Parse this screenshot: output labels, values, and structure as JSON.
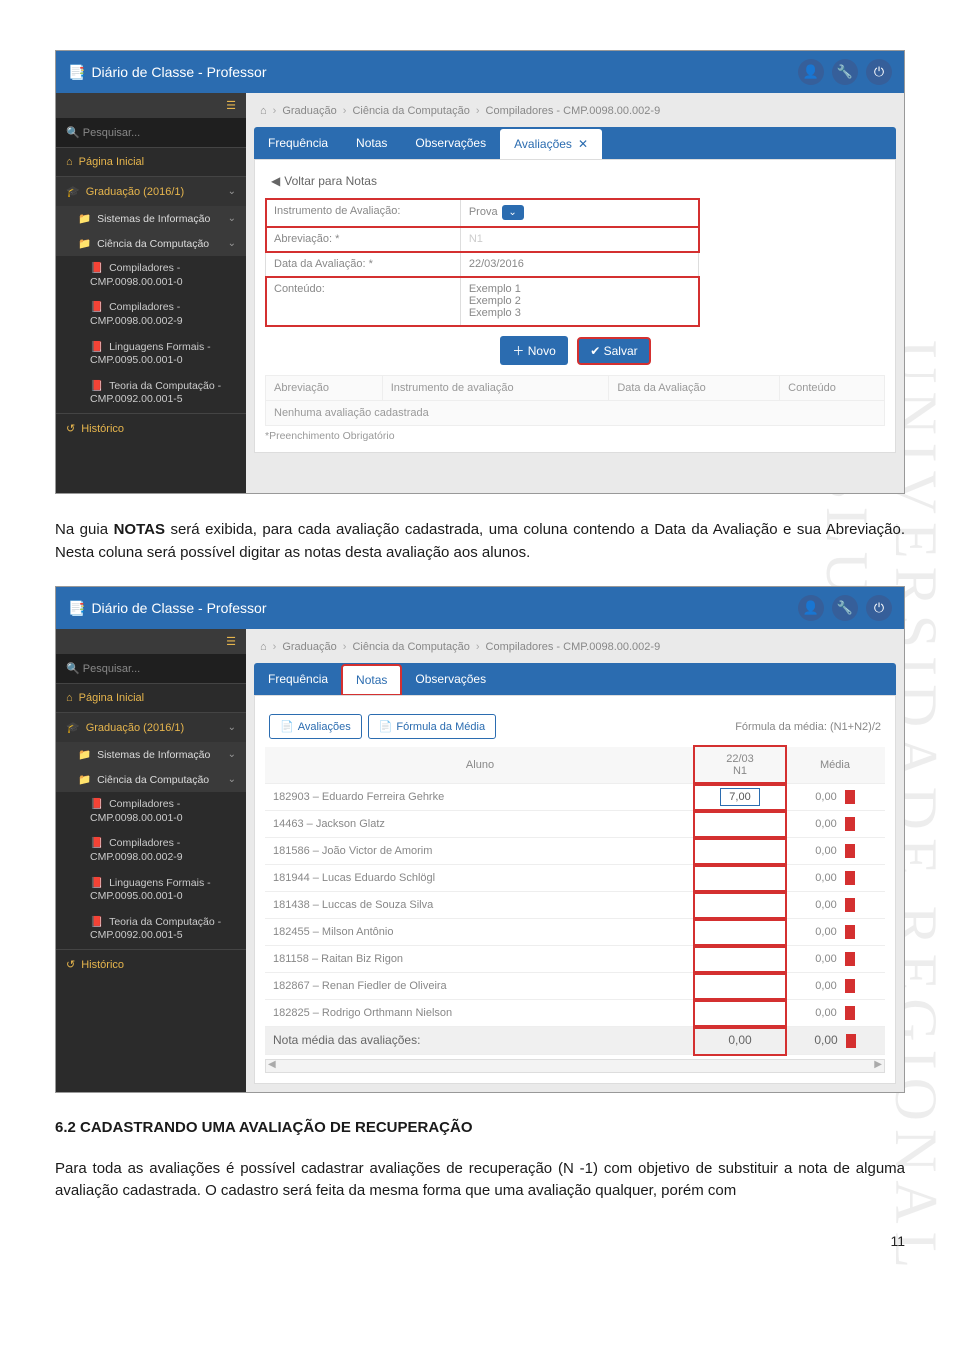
{
  "watermark": "UNIVERSIDADE REGIONAL DE BLUMENAU",
  "doc": {
    "para1_pre": "Na guia ",
    "para1_bold": "NOTAS",
    "para1_post": " será exibida, para cada avaliação cadastrada, uma coluna contendo a Data da Avaliação e sua Abreviação. Nesta coluna será possível digitar as notas desta avaliação aos alunos.",
    "heading": "6.2 CADASTRANDO UMA AVALIAÇÃO DE RECUPERAÇÃO",
    "para2": "Para toda as avaliações é possível cadastrar avaliações de recuperação (N -1) com objetivo de substituir a nota de alguma avaliação cadastrada. O cadastro será feita da mesma forma que uma avaliação qualquer, porém com",
    "pageNumber": "11"
  },
  "app": {
    "title": "Diário de Classe - Professor",
    "search_placeholder": "Pesquisar...",
    "breadcrumb": {
      "home_icon": "⌂",
      "level1": "Graduação",
      "level2": "Ciência da Computação",
      "level3": "Compiladores - CMP.0098.00.002-9"
    },
    "sidebar": {
      "home": "Página Inicial",
      "grad": "Graduação (2016/1)",
      "prog1": "Sistemas de Informação",
      "prog2": "Ciência da Computação",
      "leaf1": "Compiladores - CMP.0098.00.001-0",
      "leaf2": "Compiladores - CMP.0098.00.002-9",
      "leaf3": "Linguagens Formais - CMP.0095.00.001-0",
      "leaf4": "Teoria da Computação - CMP.0092.00.001-5",
      "hist": "Histórico"
    }
  },
  "shot1": {
    "tabs": {
      "freq": "Frequência",
      "notas": "Notas",
      "obs": "Observações",
      "aval": "Avaliações"
    },
    "back": "Voltar para Notas",
    "form": {
      "instr_label": "Instrumento de Avaliação:",
      "instr_value": "Prova",
      "abrev_label": "Abreviação: *",
      "abrev_value": "N1",
      "data_label": "Data da Avaliação: *",
      "data_value": "22/03/2016",
      "cont_label": "Conteúdo:",
      "cont_v1": "Exemplo 1",
      "cont_v2": "Exemplo 2",
      "cont_v3": "Exemplo 3"
    },
    "btn_novo": "Novo",
    "btn_salvar": "Salvar",
    "evalTable": {
      "h1": "Abreviação",
      "h2": "Instrumento de avaliação",
      "h3": "Data da Avaliação",
      "h4": "Conteúdo",
      "empty": "Nenhuma avaliação cadastrada"
    },
    "footnote": "*Preenchimento Obrigatório"
  },
  "shot2": {
    "tabs": {
      "freq": "Frequência",
      "notas": "Notas",
      "obs": "Observações"
    },
    "btn_aval": "Avaliações",
    "btn_formula": "Fórmula da Média",
    "formula_text": "Fórmula da média: (N1+N2)/2",
    "table": {
      "h_aluno": "Aluno",
      "h_date": "22/03",
      "h_code": "N1",
      "h_media": "Média",
      "rows": [
        {
          "name": "182903 – Eduardo Ferreira Gehrke",
          "n1": "7,00",
          "media": "0,00"
        },
        {
          "name": "14463 – Jackson Glatz",
          "n1": "",
          "media": "0,00"
        },
        {
          "name": "181586 – João Victor de Amorim",
          "n1": "",
          "media": "0,00"
        },
        {
          "name": "181944 – Lucas Eduardo Schlögl",
          "n1": "",
          "media": "0,00"
        },
        {
          "name": "181438 – Luccas de Souza Silva",
          "n1": "",
          "media": "0,00"
        },
        {
          "name": "182455 – Milson Antônio",
          "n1": "",
          "media": "0,00"
        },
        {
          "name": "181158 – Raitan Biz Rigon",
          "n1": "",
          "media": "0,00"
        },
        {
          "name": "182867 – Renan Fiedler de Oliveira",
          "n1": "",
          "media": "0,00"
        },
        {
          "name": "182825 – Rodrigo Orthmann Nielson",
          "n1": "",
          "media": "0,00"
        }
      ],
      "avg_label": "Nota média das avaliações:",
      "avg_n1": "0,00",
      "avg_media": "0,00"
    }
  }
}
